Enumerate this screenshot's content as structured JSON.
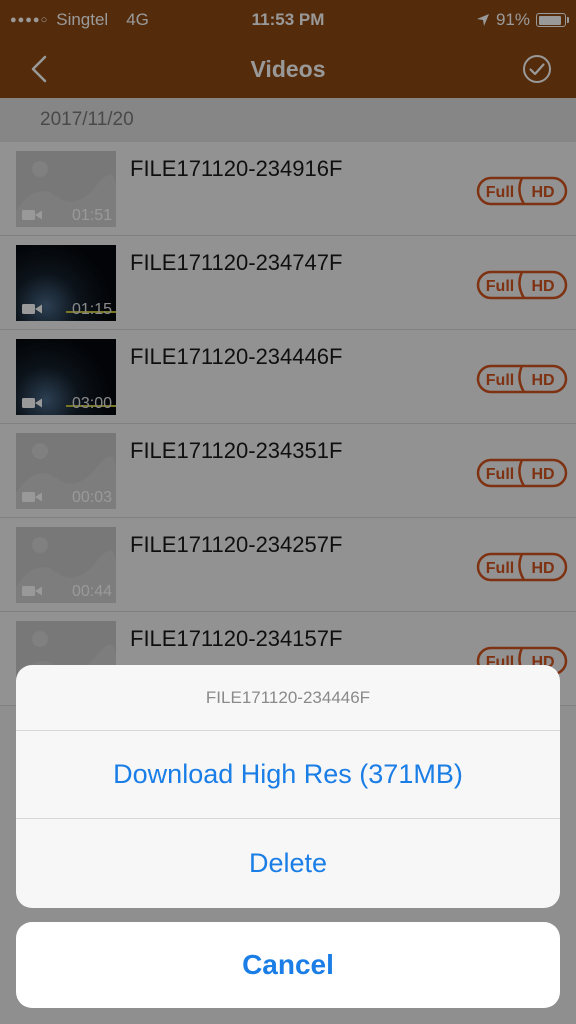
{
  "status_bar": {
    "carrier": "Singtel",
    "network": "4G",
    "time": "11:53 PM",
    "battery": "91%",
    "battery_level": 0.91
  },
  "nav": {
    "title": "Videos",
    "back_icon": "chevron-left-icon",
    "select_icon": "checkmark-circle-icon"
  },
  "section": {
    "date": "2017/11/20"
  },
  "videos": [
    {
      "name": "FILE171120-234916F",
      "duration": "01:51",
      "thumbnail": "placeholder",
      "quality": "Full HD"
    },
    {
      "name": "FILE171120-234747F",
      "duration": "01:15",
      "thumbnail": "dark",
      "quality": "Full HD"
    },
    {
      "name": "FILE171120-234446F",
      "duration": "03:00",
      "thumbnail": "dark",
      "quality": "Full HD"
    },
    {
      "name": "FILE171120-234351F",
      "duration": "00:03",
      "thumbnail": "placeholder",
      "quality": "Full HD"
    },
    {
      "name": "FILE171120-234257F",
      "duration": "00:44",
      "thumbnail": "placeholder",
      "quality": "Full HD"
    },
    {
      "name": "FILE171120-234157F",
      "duration": "",
      "thumbnail": "placeholder",
      "quality": "Full HD"
    }
  ],
  "action_sheet": {
    "title": "FILE171120-234446F",
    "download_label": "Download High Res (371MB)",
    "delete_label": "Delete",
    "cancel_label": "Cancel"
  },
  "colors": {
    "brand": "#8e4a13",
    "badge": "#d2541e",
    "action_blue": "#1a7ee6"
  }
}
